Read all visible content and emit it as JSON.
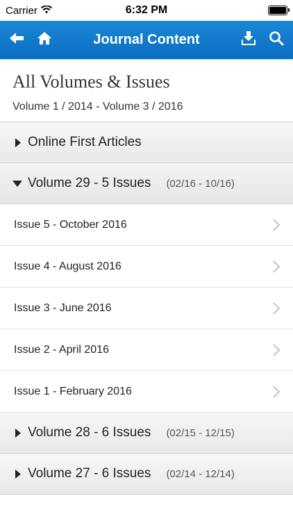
{
  "status_bar": {
    "carrier": "Carrier",
    "time": "6:32 PM",
    "battery_level": 1.0
  },
  "nav": {
    "title": "Journal Content",
    "left_icons": [
      "back-arrow-icon",
      "home-icon"
    ],
    "right_icons": [
      "download-icon",
      "search-icon"
    ],
    "color": "#0a6cc0"
  },
  "header": {
    "title": "All Volumes & Issues",
    "subtitle": "Volume 1 / 2014 - Volume 3 / 2016"
  },
  "sections": {
    "online_first": {
      "label": "Online First Articles"
    },
    "volume_29": {
      "label": "Volume 29 - 5 Issues",
      "range": "(02/16 - 10/16)",
      "issues": [
        "Issue 5 - October 2016",
        "Issue 4 - August 2016",
        "Issue 3 - June 2016",
        "Issue 2 - April 2016",
        "Issue 1 - February 2016"
      ]
    },
    "volume_28": {
      "label": "Volume 28 - 6 Issues",
      "range": "(02/15 - 12/15)"
    },
    "volume_27": {
      "label": "Volume 27 - 6 Issues",
      "range": "(02/14 - 12/14)"
    }
  }
}
